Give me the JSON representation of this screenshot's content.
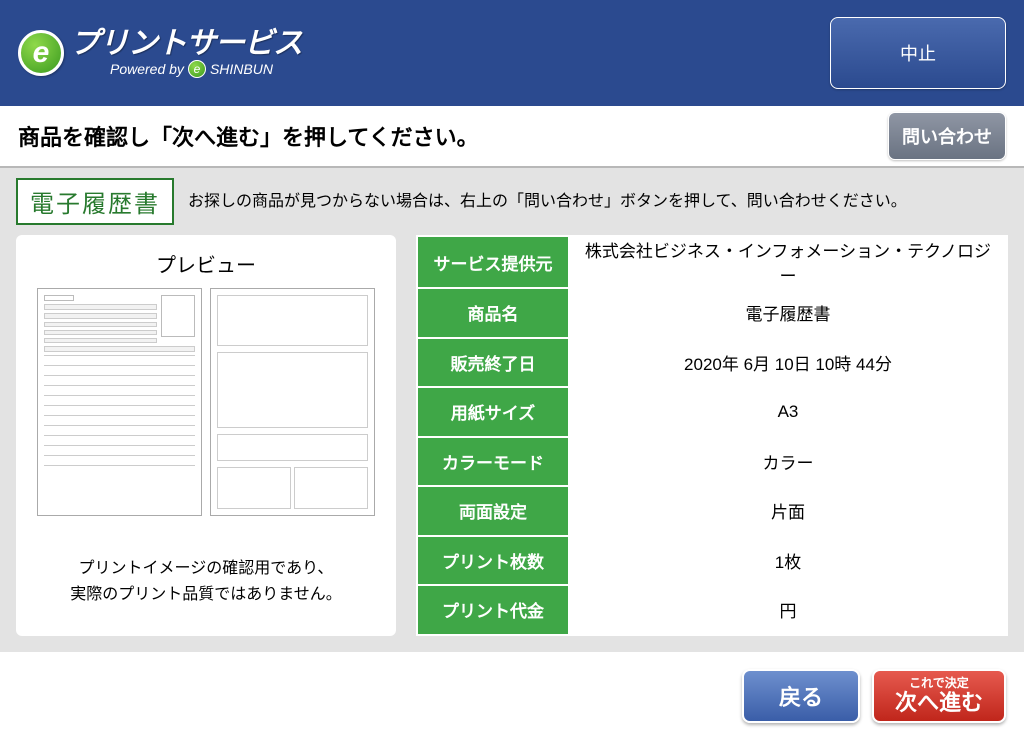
{
  "header": {
    "logo_main": "プリントサービス",
    "logo_sub_prefix": "Powered by",
    "logo_sub_brand": "SHINBUN",
    "cancel_label": "中止"
  },
  "instruction": "商品を確認し「次へ進む」を押してください。",
  "inquiry_label": "問い合わせ",
  "product_tag": "電子履歴書",
  "top_hint": "お探しの商品が見つからない場合は、右上の「問い合わせ」ボタンを押して、問い合わせください。",
  "preview": {
    "title": "プレビュー",
    "note_l1": "プリントイメージの確認用であり、",
    "note_l2": "実際のプリント品質ではありません。"
  },
  "details": {
    "rows": [
      {
        "label": "サービス提供元",
        "value": "株式会社ビジネス・インフォメーション・テクノロジー"
      },
      {
        "label": "商品名",
        "value": "電子履歴書"
      },
      {
        "label": "販売終了日",
        "value": "2020年 6月 10日 10時 44分"
      },
      {
        "label": "用紙サイズ",
        "value": "A3"
      },
      {
        "label": "カラーモード",
        "value": "カラー"
      },
      {
        "label": "両面設定",
        "value": "片面"
      },
      {
        "label": "プリント枚数",
        "value": "1枚"
      },
      {
        "label": "プリント代金",
        "value": "円"
      }
    ]
  },
  "footer": {
    "back_label": "戻る",
    "next_small": "これで決定",
    "next_big": "次へ進む"
  }
}
